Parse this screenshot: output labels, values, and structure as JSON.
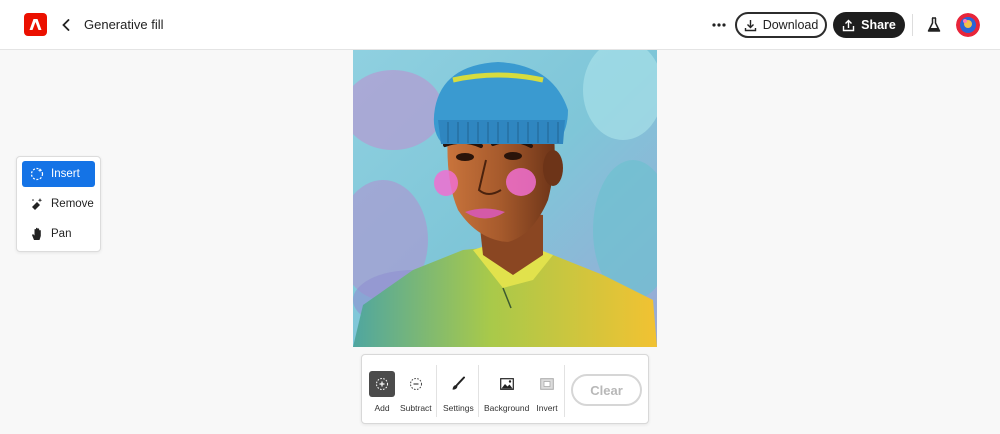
{
  "header": {
    "app_logo": "adobe-express-logo",
    "back_icon": "chevron-left-icon",
    "title": "Generative fill",
    "more_icon": "more-horizontal-icon",
    "download_label": "Download",
    "share_label": "Share",
    "flask_icon": "beaker-icon",
    "avatar": "user-avatar"
  },
  "tools": {
    "items": [
      {
        "label": "Insert",
        "icon": "insert-sparkle-icon",
        "active": true
      },
      {
        "label": "Remove",
        "icon": "eraser-icon",
        "active": false
      },
      {
        "label": "Pan",
        "icon": "hand-icon",
        "active": false
      }
    ]
  },
  "toolbar": {
    "add_label": "Add",
    "subtract_label": "Subtract",
    "settings_label": "Settings",
    "background_label": "Background",
    "invert_label": "Invert",
    "clear_label": "Clear"
  },
  "colors": {
    "accent": "#1473e6",
    "brand": "#eb1000",
    "share_bg": "#1e1e1e"
  }
}
